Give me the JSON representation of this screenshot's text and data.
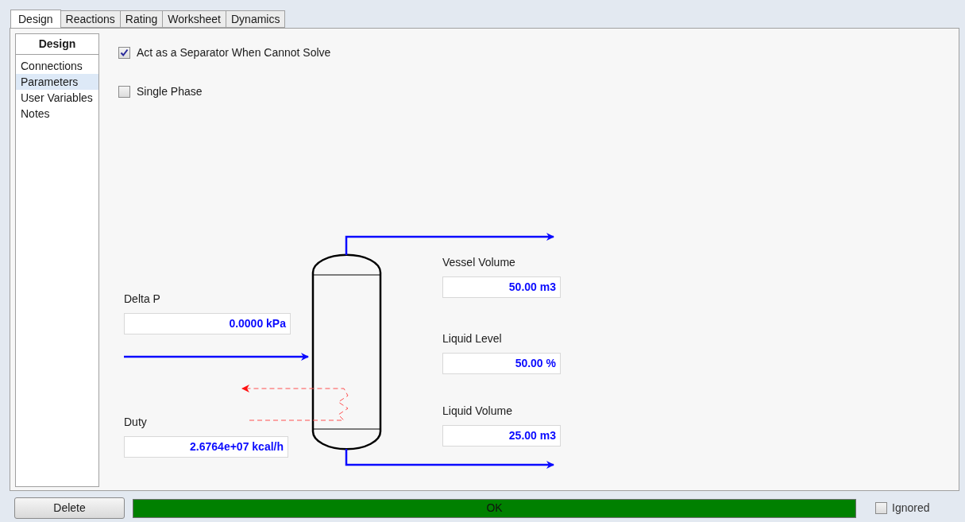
{
  "tabs": [
    {
      "label": "Design",
      "selected": true
    },
    {
      "label": "Reactions",
      "selected": false
    },
    {
      "label": "Rating",
      "selected": false
    },
    {
      "label": "Worksheet",
      "selected": false
    },
    {
      "label": "Dynamics",
      "selected": false
    }
  ],
  "sidebar": {
    "header": "Design",
    "items": [
      {
        "label": "Connections",
        "selected": false
      },
      {
        "label": "Parameters",
        "selected": true
      },
      {
        "label": "User Variables",
        "selected": false
      },
      {
        "label": "Notes",
        "selected": false
      }
    ]
  },
  "options": [
    {
      "label": "Act as a Separator When Cannot Solve",
      "checked": true
    },
    {
      "label": "Single Phase",
      "checked": false
    }
  ],
  "fields": [
    {
      "label": "Delta P",
      "value": "0.0000 kPa"
    },
    {
      "label": "Duty",
      "value": "2.6764e+07 kcal/h"
    },
    {
      "label": "Vessel Volume",
      "value": "50.00 m3"
    },
    {
      "label": "Liquid Level",
      "value": "50.00 %"
    },
    {
      "label": "Liquid Volume",
      "value": "25.00 m3"
    }
  ],
  "footer": {
    "delete_button": "Delete",
    "status": "OK",
    "ignored": {
      "label": "Ignored",
      "checked": false
    }
  }
}
